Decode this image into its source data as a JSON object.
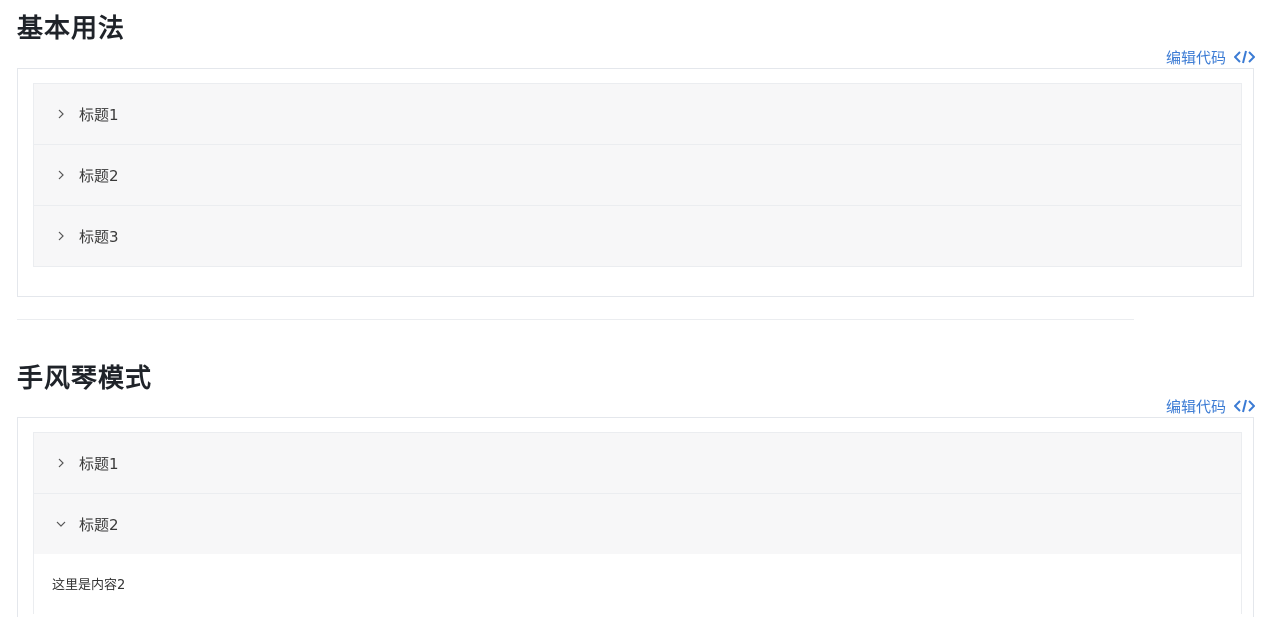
{
  "sections": [
    {
      "title": "基本用法",
      "edit_code_label": "编辑代码",
      "items": [
        {
          "label": "标题1",
          "expanded": false
        },
        {
          "label": "标题2",
          "expanded": false
        },
        {
          "label": "标题3",
          "expanded": false
        }
      ]
    },
    {
      "title": "手风琴模式",
      "edit_code_label": "编辑代码",
      "items": [
        {
          "label": "标题1",
          "expanded": false
        },
        {
          "label": "标题2",
          "expanded": true,
          "content": "这里是内容2"
        }
      ]
    }
  ],
  "icons": {
    "edit_code": "code-icon",
    "collapsed": "chevron-right-icon",
    "expanded": "chevron-down-icon"
  },
  "colors": {
    "link": "#3b7bd4",
    "header_bg": "#f7f7f8",
    "border": "#ebedf0"
  }
}
